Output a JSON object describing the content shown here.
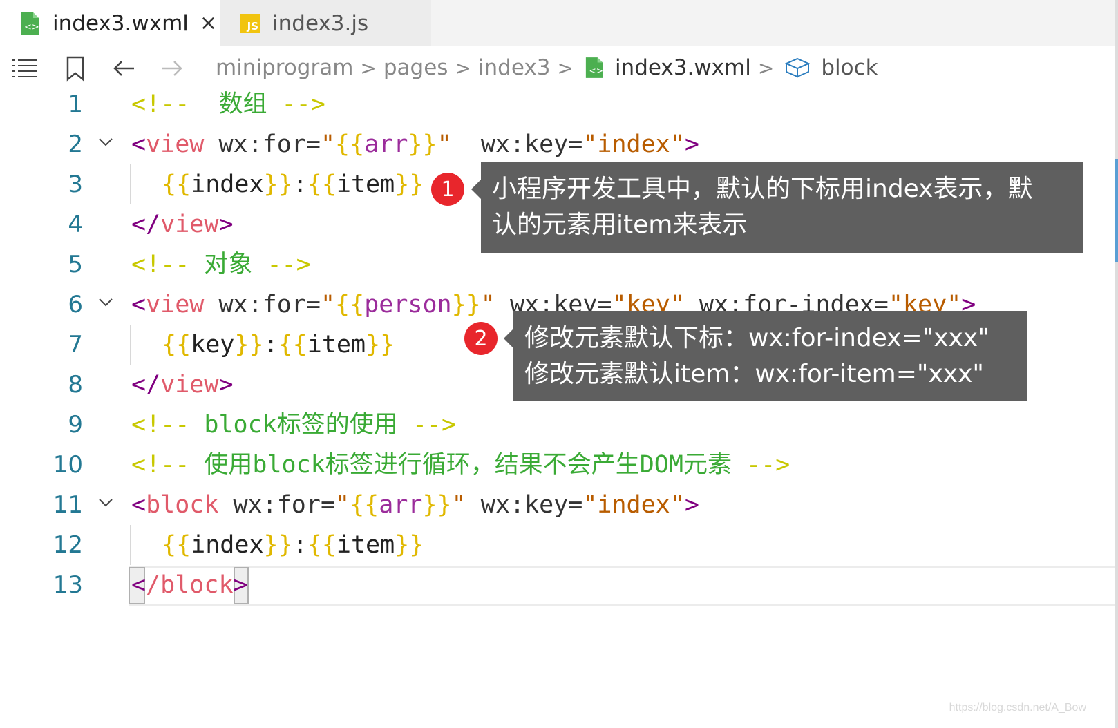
{
  "tabs": [
    {
      "label": "index3.wxml",
      "close": "×",
      "icon": "wxml-file-icon"
    },
    {
      "label": "index3.js",
      "icon": "js-file-icon",
      "icon_text": "JS"
    }
  ],
  "breadcrumb": {
    "items": [
      "miniprogram",
      "pages",
      "index3"
    ],
    "file": "index3.wxml",
    "symbol": "block",
    "separator": ">"
  },
  "line_numbers": [
    "1",
    "2",
    "3",
    "4",
    "5",
    "6",
    "7",
    "8",
    "9",
    "10",
    "11",
    "12",
    "13"
  ],
  "code": {
    "l1": {
      "open": "<!--",
      "text": "数组",
      "close": "-->"
    },
    "l2": {
      "lt": "<",
      "tag": "view",
      "a1": "wx:for",
      "eq": "=",
      "q": "\"",
      "ob": "{{",
      "v": "arr",
      "cb": "}}",
      "a2": "wx:key",
      "s2": "\"index\"",
      "gt": ">"
    },
    "l3": {
      "ob": "{{",
      "v1": "index",
      "cb": "}}",
      "colon": ":",
      "v2": "item"
    },
    "l4": {
      "open": "</",
      "tag": "view",
      "gt": ">"
    },
    "l5": {
      "open": "<!--",
      "text": "对象",
      "close": "-->"
    },
    "l6": {
      "lt": "<",
      "tag": "view",
      "a1": "wx:for",
      "v": "person",
      "a2": "wx:key",
      "s2": "\"key\"",
      "a3": "wx:for-index",
      "s3": "\"key\"",
      "gt": ">"
    },
    "l7": {
      "v1": "key",
      "v2": "item"
    },
    "l8": {
      "open": "</",
      "tag": "view",
      "gt": ">"
    },
    "l9": {
      "open": "<!--",
      "text": "block标签的使用",
      "close": "-->"
    },
    "l10": {
      "open": "<!--",
      "text": "使用block标签进行循环，结果不会产生DOM元素",
      "close": "-->"
    },
    "l11": {
      "lt": "<",
      "tag": "block",
      "a1": "wx:for",
      "v": "arr",
      "a2": "wx:key",
      "s2": "\"index\"",
      "gt": ">"
    },
    "l12": {
      "v1": "index",
      "v2": "item"
    },
    "l13": {
      "lt": "<",
      "slash": "/",
      "tag": "block",
      "gt": ">"
    }
  },
  "callouts": [
    {
      "badge": "1",
      "line1": "小程序开发工具中，默认的下标用index表示，默",
      "line2": "认的元素用item来表示"
    },
    {
      "badge": "2",
      "line1": "修改元素默认下标：wx:for-index=\"xxx\"",
      "line2": "修改元素默认item：wx:for-item=\"xxx\""
    }
  ],
  "watermark": "https://blog.csdn.net/A_Bow",
  "colors": {
    "accent": "#5f5f5f",
    "badge": "#e8262c",
    "line_number": "#237893"
  }
}
